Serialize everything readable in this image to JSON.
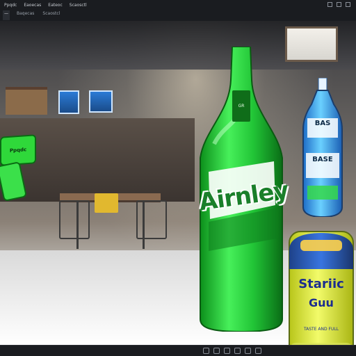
{
  "app": {
    "menu": [
      "Ppqdc",
      "Eaoecas",
      "Eateoc",
      "Scaosctl"
    ],
    "tabs": [
      "—",
      "Baqecas",
      "Scaostcl"
    ],
    "active_tab_index": 0
  },
  "viewport": {
    "green_sign_text": "Ppqdc",
    "bottle": {
      "brand_text": "Airnley",
      "neck_label_text": "GR"
    },
    "blue_bottle": {
      "top_text": "BAS",
      "middle_text": "BASE"
    },
    "can": {
      "line1": "Stariic",
      "line2": "Guu",
      "small_text": "TASTE AND FULL"
    },
    "signs": [
      "",
      ""
    ]
  },
  "statusbar": {
    "right_text": ""
  },
  "colors": {
    "bottle_green": "#2fd83a",
    "blue_bottle": "#2f8ef0",
    "can_yellow": "#e8f04a",
    "ui_dark": "#1a1c20"
  }
}
